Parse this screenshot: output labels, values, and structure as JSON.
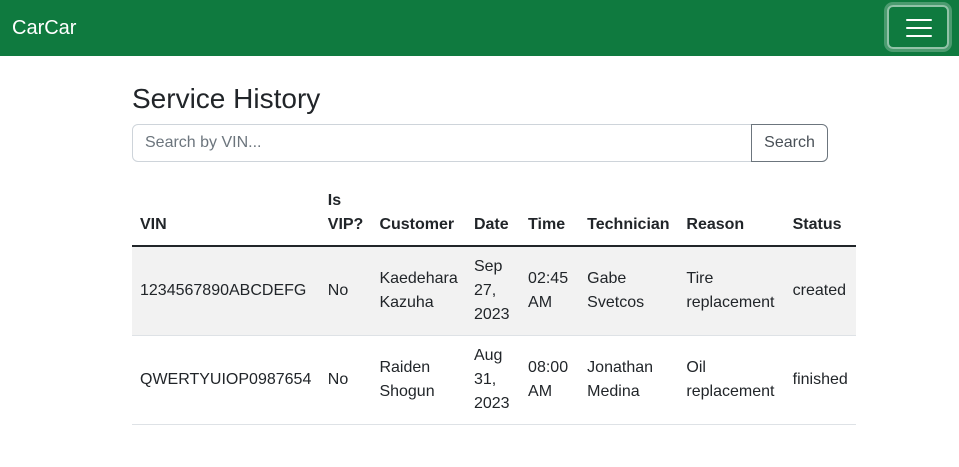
{
  "navbar": {
    "brand": "CarCar",
    "toggler_icon": "hamburger-menu-icon",
    "color": "#0f7a3f"
  },
  "page": {
    "title": "Service History"
  },
  "search": {
    "placeholder": "Search by VIN...",
    "value": "",
    "button_label": "Search"
  },
  "table": {
    "headers": {
      "vin": "VIN",
      "vip": "Is VIP?",
      "customer": "Customer",
      "date": "Date",
      "time": "Time",
      "technician": "Technician",
      "reason": "Reason",
      "status": "Status"
    },
    "rows": [
      {
        "vin": "1234567890ABCDEFG",
        "vip": "No",
        "customer": "Kaedehara Kazuha",
        "date": "Sep 27, 2023",
        "time": "02:45 AM",
        "technician": "Gabe Svetcos",
        "reason": "Tire replacement",
        "status": "created"
      },
      {
        "vin": "QWERTYUIOP0987654",
        "vip": "No",
        "customer": "Raiden Shogun",
        "date": "Aug 31, 2023",
        "time": "08:00 AM",
        "technician": "Jonathan Medina",
        "reason": "Oil replacement",
        "status": "finished"
      }
    ]
  }
}
